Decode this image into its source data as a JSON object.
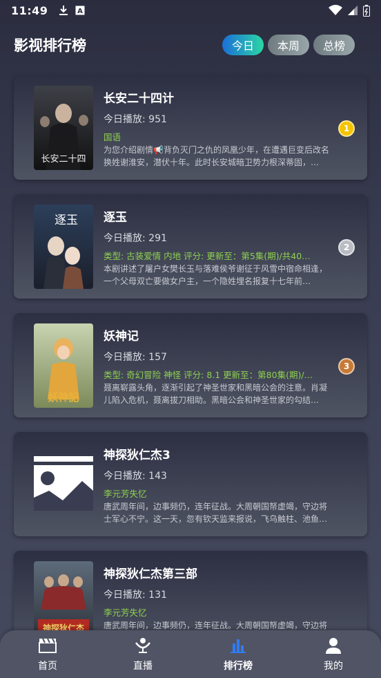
{
  "status_bar": {
    "time": "11:49"
  },
  "header": {
    "title": "影视排行榜",
    "tabs": [
      {
        "label": "今日",
        "active": true
      },
      {
        "label": "本周",
        "active": false
      },
      {
        "label": "总榜",
        "active": false
      }
    ]
  },
  "list": [
    {
      "title": "长安二十四计",
      "plays": "今日播放: 951",
      "tag": "国语",
      "desc": "为您介绍剧情📢背负灭门之仇的凤凰少年，在遭遇巨变后改名换姓谢淮安，潜伏十年。此时长安城暗卫势力根深蒂固，…",
      "rank": "1",
      "rank_color": "#f5c400",
      "poster": "poster-1"
    },
    {
      "title": "逐玉",
      "plays": "今日播放: 291",
      "tag": "类型: 古装爱情   内地   评分:    更新至：第5集(期)/共40…",
      "desc": "本剧讲述了屠户女樊长玉与落难侯爷谢征于风雪中宿命相逢，一个父母双亡要做女户主，一个隐姓埋名报复十七年前…",
      "rank": "2",
      "rank_color": "#b9bcc2",
      "poster": "poster-2"
    },
    {
      "title": "妖神记",
      "plays": "今日播放: 157",
      "tag": "类型: 奇幻冒险   神怪   评分:  8.1 更新至：第80集(期)/…",
      "desc": "聂离崭露头角，逐渐引起了神圣世家和黑暗公会的注意。肖凝儿陷入危机，聂离拔刀相助。黑暗公会和神圣世家的勾结…",
      "rank": "3",
      "rank_color": "#c77a36",
      "poster": "poster-3"
    },
    {
      "title": "神探狄仁杰3",
      "plays": "今日播放: 143",
      "tag": "李元芳失忆",
      "desc": "唐武周年间，边事频仍，连年征战。大周朝国帑虚竭，守边将士军心不宁。这一天，忽有钦天监来报说，飞乌触柱、池鱼殃死、天现异…",
      "rank": "",
      "rank_color": "",
      "poster": "placeholder"
    },
    {
      "title": "神探狄仁杰第三部",
      "plays": "今日播放: 131",
      "tag": "李元芳失忆",
      "desc": "唐武周年间，边事频仍，连年征战。大周朝国帑虚竭，守边将士军心不宁。这一天，忽有钦天监来报说，飞乌触柱、池鱼殃死、天现异…",
      "rank": "",
      "rank_color": "",
      "poster": "poster-5"
    }
  ],
  "bottom_nav": [
    {
      "label": "首页",
      "icon": "clapperboard-icon",
      "active": false
    },
    {
      "label": "直播",
      "icon": "live-icon",
      "active": false
    },
    {
      "label": "排行榜",
      "icon": "bar-chart-icon",
      "active": true
    },
    {
      "label": "我的",
      "icon": "user-icon",
      "active": false
    }
  ],
  "colors": {
    "active_tab_start": "#1b6fd8",
    "active_tab_end": "#2bd6a5",
    "tag_green": "#8fd14f",
    "nav_active_blue": "#2f7cf6"
  }
}
